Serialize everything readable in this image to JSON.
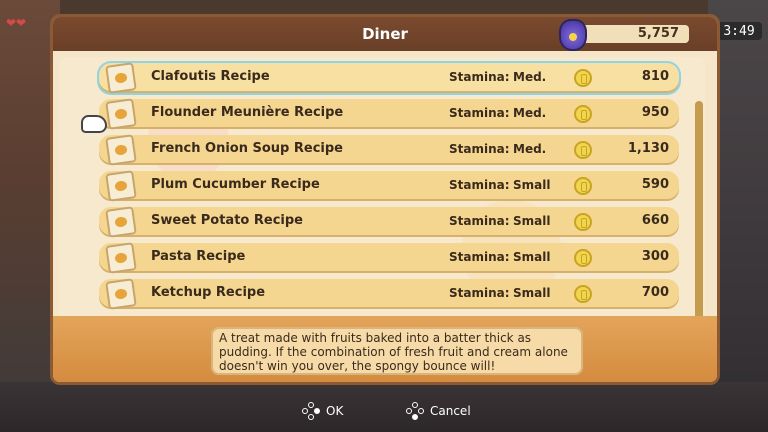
{
  "hud": {
    "clock": "3:49"
  },
  "window": {
    "title": "Diner"
  },
  "money": {
    "amount": "5,757"
  },
  "recipes": [
    {
      "name": "Clafoutis Recipe",
      "stamina_label": "Stamina:",
      "stamina": "Med.",
      "price": "810"
    },
    {
      "name": "Flounder Meunière Recipe",
      "stamina_label": "Stamina:",
      "stamina": "Med.",
      "price": "950"
    },
    {
      "name": "French Onion Soup Recipe",
      "stamina_label": "Stamina:",
      "stamina": "Med.",
      "price": "1,130"
    },
    {
      "name": "Plum Cucumber Recipe",
      "stamina_label": "Stamina:",
      "stamina": "Small",
      "price": "590"
    },
    {
      "name": "Sweet Potato Recipe",
      "stamina_label": "Stamina:",
      "stamina": "Small",
      "price": "660"
    },
    {
      "name": "Pasta Recipe",
      "stamina_label": "Stamina:",
      "stamina": "Small",
      "price": "300"
    },
    {
      "name": "Ketchup Recipe",
      "stamina_label": "Stamina:",
      "stamina": "Small",
      "price": "700"
    }
  ],
  "description": "A treat made with fruits baked into a batter thick as pudding. If the combination of fresh fruit and cream alone doesn't win you over, the spongy bounce will!",
  "footer": {
    "ok_label": "OK",
    "cancel_label": "Cancel"
  },
  "icons": {
    "money": "money-bag-icon",
    "coin": "coin-icon",
    "recipe": "recipe-card-icon",
    "cursor": "hand-pointer-icon",
    "scroll_down": "down-arrow-icon"
  },
  "colors": {
    "header": "#7a4a2f",
    "row": "#f4d691",
    "selected_outline": "#8ed3e6",
    "description_bg": "#d48b3f"
  }
}
